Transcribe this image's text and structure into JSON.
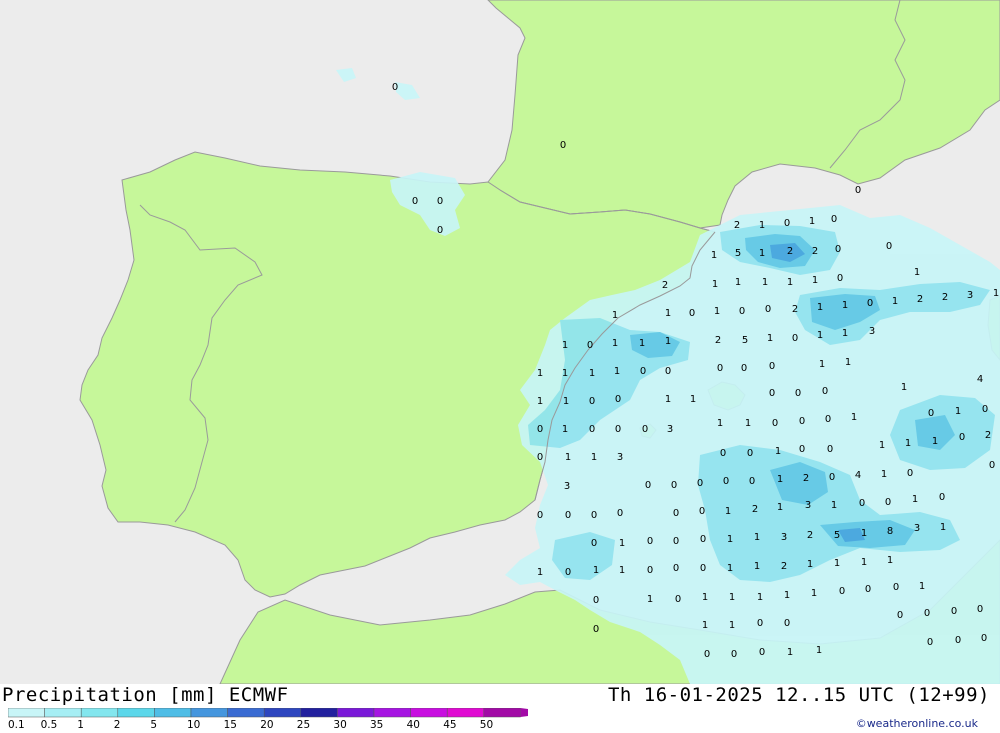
{
  "header": {
    "title": "Precipitation [mm] ECMWF",
    "valid_time": "Th 16-01-2025 12..15 UTC (12+99)",
    "credit": "©weatheronline.co.uk"
  },
  "legend": {
    "labels": [
      "0.1",
      "0.5",
      "1",
      "2",
      "5",
      "10",
      "15",
      "20",
      "25",
      "30",
      "35",
      "40",
      "45",
      "50"
    ],
    "colors": [
      "#c8f5f7",
      "#a6eef4",
      "#83e6ee",
      "#5cd7ea",
      "#4fbde6",
      "#4596de",
      "#3a6bd2",
      "#2e46bf",
      "#22209e",
      "#7a18d8",
      "#a614e2",
      "#c80ee0",
      "#e00ad2",
      "#a20aa6"
    ]
  },
  "colors": {
    "sea": "#ececec",
    "land": "#c6f79a",
    "border": "#9a9a9a",
    "precip_light": "#c8f5f7",
    "precip_mid": "#8fe4f0",
    "precip_heavy": "#5cc8e6",
    "precip_max": "#3fa4de"
  },
  "map_values": [
    "0",
    "0",
    "0",
    "0",
    "0",
    "2",
    "1",
    "0",
    "1",
    "0",
    "0",
    "1",
    "5",
    "1",
    "2",
    "2",
    "0",
    "0",
    "1",
    "1",
    "1",
    "1",
    "1",
    "0",
    "1",
    "2",
    "1",
    "1",
    "0",
    "1",
    "2",
    "2",
    "3",
    "1",
    "2",
    "1",
    "1",
    "0",
    "1",
    "0",
    "0",
    "1",
    "1",
    "3",
    "1",
    "0",
    "1",
    "1",
    "1",
    "2",
    "5",
    "1",
    "0",
    "1",
    "1",
    "1",
    "1",
    "0",
    "0",
    "0",
    "0",
    "0",
    "1",
    "1",
    "1",
    "1",
    "0",
    "0",
    "1",
    "1",
    "0",
    "0",
    "0",
    "1",
    "4",
    "0",
    "1",
    "0",
    "0",
    "0",
    "3",
    "1",
    "1",
    "0",
    "0",
    "0",
    "1",
    "0",
    "1",
    "0",
    "0",
    "1",
    "1",
    "3",
    "0",
    "0",
    "1",
    "0",
    "0",
    "1",
    "1",
    "1",
    "0",
    "2",
    "3",
    "0",
    "0",
    "0",
    "0",
    "0",
    "1",
    "2",
    "0",
    "4",
    "1",
    "0",
    "0",
    "0",
    "0",
    "0",
    "0",
    "0",
    "0",
    "1",
    "2",
    "1",
    "3",
    "1",
    "0",
    "0",
    "1",
    "0",
    "0",
    "1",
    "0",
    "0",
    "0",
    "1",
    "1",
    "3",
    "2",
    "5",
    "1",
    "8",
    "3",
    "1",
    "1",
    "0",
    "1",
    "1",
    "0",
    "0",
    "0",
    "1",
    "1",
    "2",
    "1",
    "1",
    "1",
    "1",
    "0",
    "1",
    "0",
    "1",
    "1",
    "1",
    "1",
    "1",
    "0",
    "0",
    "0",
    "1",
    "0",
    "1",
    "1",
    "0",
    "0",
    "0",
    "0",
    "0",
    "0",
    "0",
    "0",
    "0",
    "1",
    "1",
    "0",
    "0",
    "0",
    "1",
    "1",
    "1",
    "0",
    "0",
    "0",
    "0",
    "1"
  ]
}
